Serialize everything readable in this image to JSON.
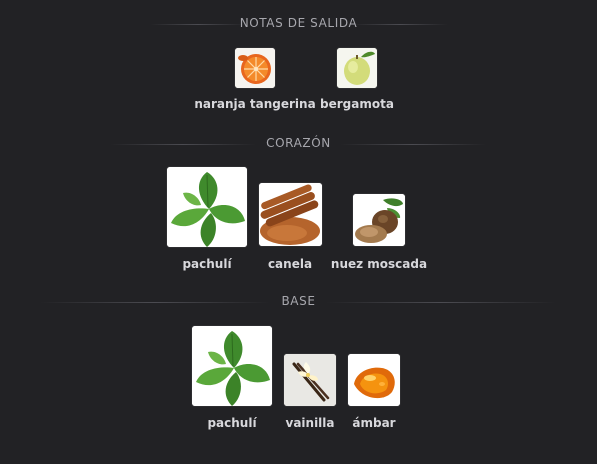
{
  "sections": [
    {
      "title": "NOTAS DE SALIDA",
      "notes": [
        {
          "label": "naranja tangerina",
          "icon": "orange-icon"
        },
        {
          "label": "bergamota",
          "icon": "bergamot-icon"
        }
      ]
    },
    {
      "title": "CORAZÓN",
      "notes": [
        {
          "label": "pachulí",
          "icon": "patchouli-icon"
        },
        {
          "label": "canela",
          "icon": "cinnamon-icon"
        },
        {
          "label": "nuez moscada",
          "icon": "nutmeg-icon"
        }
      ]
    },
    {
      "title": "BASE",
      "notes": [
        {
          "label": "pachulí",
          "icon": "patchouli-icon"
        },
        {
          "label": "vainilla",
          "icon": "vanilla-icon"
        },
        {
          "label": "ámbar",
          "icon": "amber-icon"
        }
      ]
    }
  ],
  "colors": {
    "background": "#222225",
    "heading": "#a7a7ad",
    "label": "#d8d8dc"
  }
}
